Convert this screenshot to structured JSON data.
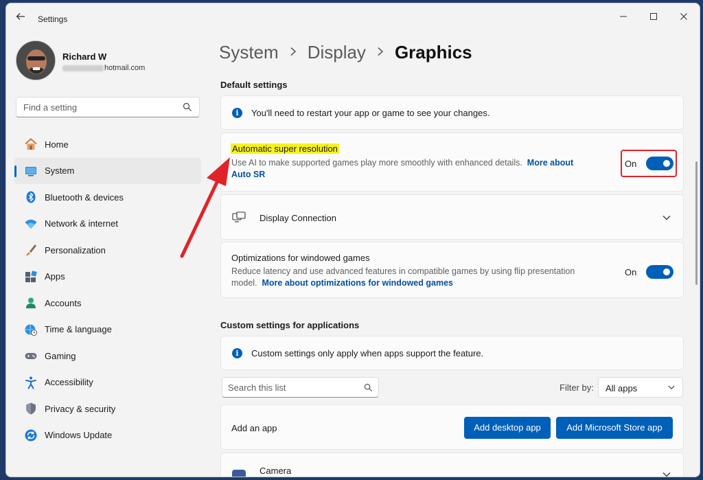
{
  "window": {
    "title": "Settings",
    "back_icon": "back-arrow-icon",
    "minimize_icon": "minimize-icon",
    "maximize_icon": "maximize-icon",
    "close_icon": "close-icon"
  },
  "profile": {
    "name": "Richard W",
    "email_visible": "hotmail.com"
  },
  "search": {
    "placeholder": "Find a setting"
  },
  "sidebar": {
    "items": [
      {
        "label": "Home",
        "icon": "home-icon",
        "active": false
      },
      {
        "label": "System",
        "icon": "system-icon",
        "active": true
      },
      {
        "label": "Bluetooth & devices",
        "icon": "bluetooth-icon",
        "active": false
      },
      {
        "label": "Network & internet",
        "icon": "wifi-icon",
        "active": false
      },
      {
        "label": "Personalization",
        "icon": "brush-icon",
        "active": false
      },
      {
        "label": "Apps",
        "icon": "apps-icon",
        "active": false
      },
      {
        "label": "Accounts",
        "icon": "account-icon",
        "active": false
      },
      {
        "label": "Time & language",
        "icon": "globe-clock-icon",
        "active": false
      },
      {
        "label": "Gaming",
        "icon": "gamepad-icon",
        "active": false
      },
      {
        "label": "Accessibility",
        "icon": "accessibility-icon",
        "active": false
      },
      {
        "label": "Privacy & security",
        "icon": "shield-icon",
        "active": false
      },
      {
        "label": "Windows Update",
        "icon": "update-icon",
        "active": false
      }
    ]
  },
  "breadcrumb": {
    "items": [
      "System",
      "Display",
      "Graphics"
    ]
  },
  "default_settings": {
    "title": "Default settings",
    "info_text": "You'll need to restart your app or game to see your changes.",
    "auto_sr": {
      "title": "Automatic super resolution",
      "description": "Use AI to make supported games play more smoothly with enhanced details.",
      "link": "More about Auto SR",
      "link_part1": "More about",
      "link_part2": "Auto SR",
      "toggle_label": "On",
      "toggle_on": true
    },
    "display_connection": {
      "title": "Display Connection"
    },
    "windowed_games": {
      "title": "Optimizations for windowed games",
      "description_line1": "Reduce latency and use advanced features in compatible games by using flip presentation",
      "description_line2": "model.",
      "link": "More about optimizations for windowed games",
      "toggle_label": "On",
      "toggle_on": true
    }
  },
  "custom_settings": {
    "title": "Custom settings for applications",
    "info_text": "Custom settings only apply when apps support the feature.",
    "search_placeholder": "Search this list",
    "filter_label": "Filter by:",
    "filter_value": "All apps",
    "add_app_label": "Add an app",
    "add_desktop_button": "Add desktop app",
    "add_store_button": "Add Microsoft Store app",
    "apps": [
      {
        "name": "Camera"
      }
    ]
  },
  "colors": {
    "accent": "#005fb8",
    "highlight": "#f7f21b",
    "annotation_red": "#e0242a"
  }
}
